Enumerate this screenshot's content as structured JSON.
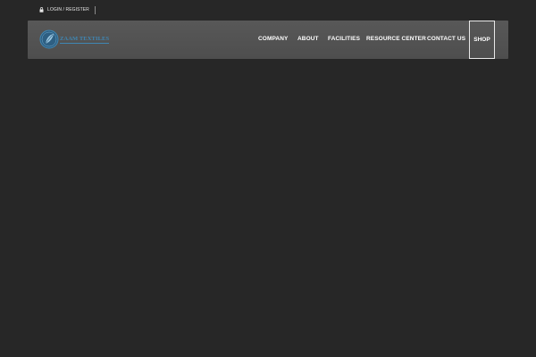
{
  "topbar": {
    "login_label": "LOGIN / REGISTER",
    "lock_icon": "lock-icon"
  },
  "header": {
    "logo_text": "ZAAM TEXTILES",
    "logo_icon": "leaf-logo-icon",
    "brand_color": "#3f86b3"
  },
  "nav": {
    "items": [
      {
        "label": "COMPANY"
      },
      {
        "label": "ABOUT"
      },
      {
        "label": "FACILITIES"
      },
      {
        "label": "RESOURCE CENTER"
      },
      {
        "label": "CONTACT US"
      }
    ],
    "shop_label": "SHOP"
  },
  "colors": {
    "page_background": "#272727",
    "header_background": "#555555",
    "nav_text": "#ffffff"
  }
}
